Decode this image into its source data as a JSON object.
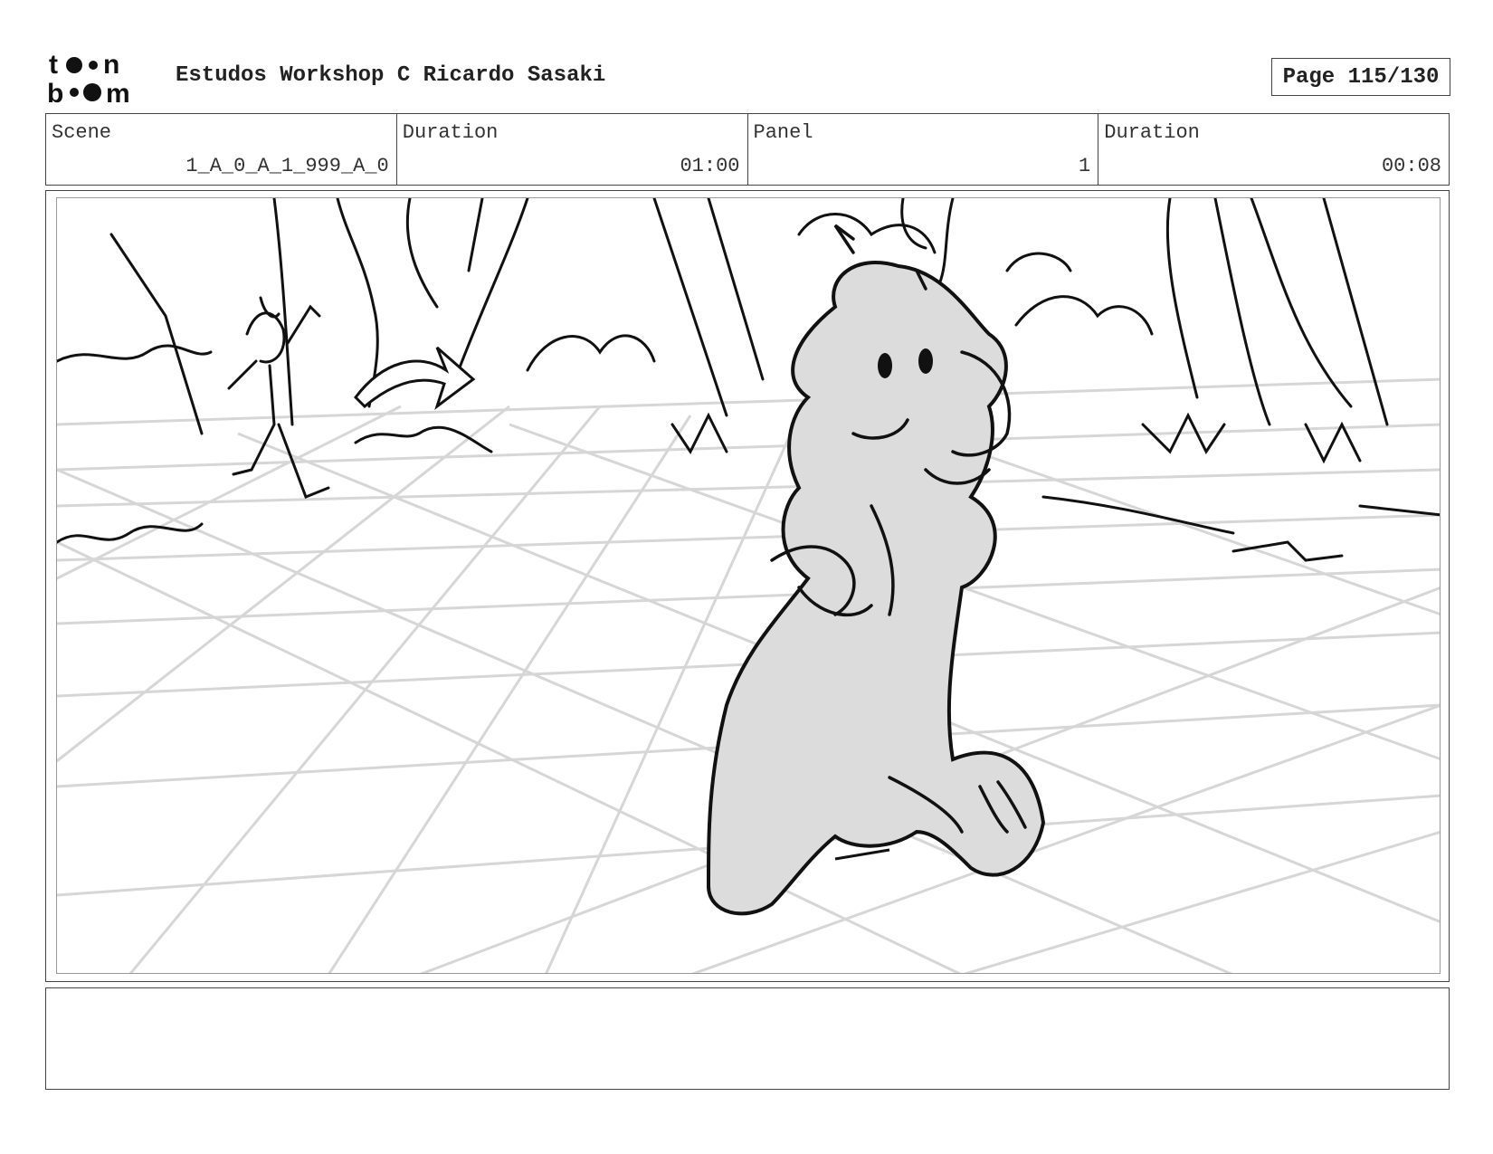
{
  "header": {
    "logo_text": "toon boom",
    "title": "Estudos Workshop C Ricardo Sasaki",
    "page": "Page 115/130"
  },
  "info": {
    "scene_label": "Scene",
    "scene_value": "1_A_0_A_1_999_A_0",
    "scene_duration_label": "Duration",
    "scene_duration_value": "01:00",
    "panel_label": "Panel",
    "panel_value": "1",
    "panel_duration_label": "Duration",
    "panel_duration_value": "00:08"
  },
  "notes": {
    "text": ""
  }
}
